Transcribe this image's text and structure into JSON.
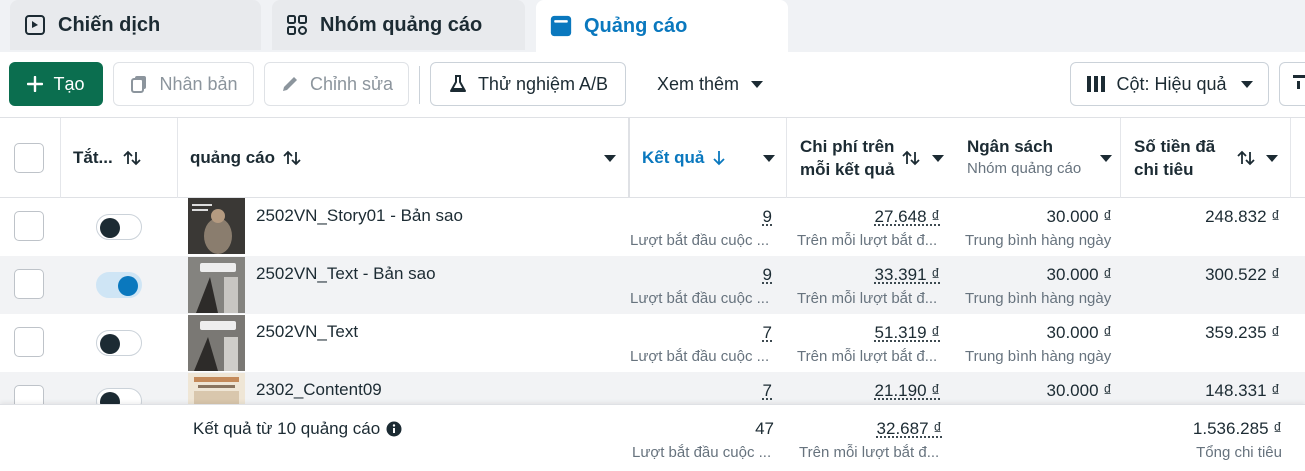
{
  "tabs": [
    {
      "label": "Chiến dịch",
      "icon": "campaign-flag-icon"
    },
    {
      "label": "Nhóm quảng cáo",
      "icon": "grid-icon"
    },
    {
      "label": "Quảng cáo",
      "icon": "ad-window-icon"
    }
  ],
  "toolbar": {
    "create": "Tạo",
    "duplicate": "Nhân bản",
    "edit": "Chỉnh sửa",
    "ab_test": "Thử nghiệm A/B",
    "more": "Xem thêm",
    "columns": "Cột: Hiệu quả"
  },
  "header": {
    "toggle_col": "Tắt...",
    "ad_col": "quảng cáo",
    "results": "Kết quả",
    "cpr_line1": "Chi phí trên",
    "cpr_line2": "mỗi kết quả",
    "budget": "Ngân sách",
    "budget_sub": "Nhóm quảng cáo",
    "spent_line1": "Số tiền đã",
    "spent_line2": "chi tiêu"
  },
  "rows": [
    {
      "name": "2502VN_Story01 - Bản sao",
      "on": false,
      "results": "9",
      "results_caption": "Lượt bắt đầu cuộc ...",
      "cpr": "27.648 ₫",
      "cpr_caption": "Trên mỗi lượt bắt đ...",
      "budget": "30.000 ₫",
      "budget_caption": "Trung bình hàng ngày",
      "spent": "248.832 ₫"
    },
    {
      "name": "2502VN_Text - Bản sao",
      "on": true,
      "results": "9",
      "results_caption": "Lượt bắt đầu cuộc ...",
      "cpr": "33.391 ₫",
      "cpr_caption": "Trên mỗi lượt bắt đ...",
      "budget": "30.000 ₫",
      "budget_caption": "Trung bình hàng ngày",
      "spent": "300.522 ₫"
    },
    {
      "name": "2502VN_Text",
      "on": false,
      "results": "7",
      "results_caption": "Lượt bắt đầu cuộc ...",
      "cpr": "51.319 ₫",
      "cpr_caption": "Trên mỗi lượt bắt đ...",
      "budget": "30.000 ₫",
      "budget_caption": "Trung bình hàng ngày",
      "spent": "359.235 ₫"
    },
    {
      "name": "2302_Content09",
      "on": false,
      "results": "7",
      "results_caption": "",
      "cpr": "21.190 ₫",
      "cpr_caption": "",
      "budget": "30.000 ₫",
      "budget_caption": "",
      "spent": "148.331 ₫"
    }
  ],
  "footer": {
    "label": "Kết quả từ 10 quảng cáo",
    "results": "47",
    "results_caption": "Lượt bắt đầu cuộc ...",
    "cpr": "32.687 ₫",
    "cpr_caption": "Trên mỗi lượt bắt đ...",
    "spent": "1.536.285 ₫",
    "spent_caption": "Tổng chi tiêu"
  },
  "colors": {
    "accent": "#0a78be",
    "primary_button": "#0b6e4f"
  }
}
